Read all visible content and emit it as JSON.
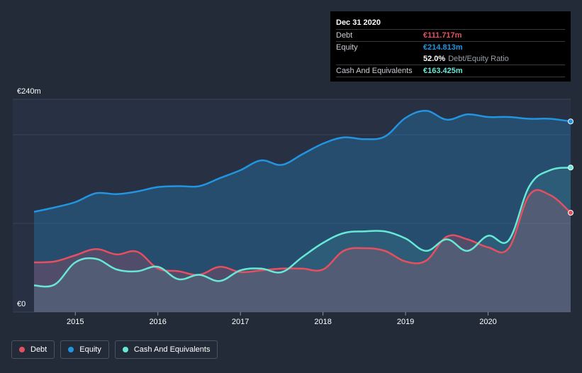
{
  "colors": {
    "debt": "#e64f5f",
    "equity": "#2394df",
    "cash": "#67e8d6"
  },
  "tooltip": {
    "date": "Dec 31 2020",
    "debt_label": "Debt",
    "debt_value": "€111.717m",
    "equity_label": "Equity",
    "equity_value": "€214.813m",
    "ratio_value": "52.0%",
    "ratio_label": "Debt/Equity Ratio",
    "cash_label": "Cash And Equivalents",
    "cash_value": "€163.425m"
  },
  "legend": {
    "debt": "Debt",
    "equity": "Equity",
    "cash": "Cash And Equivalents"
  },
  "chart_data": {
    "type": "area",
    "ylim": [
      0,
      240
    ],
    "y_ticks": [
      {
        "value": 240,
        "label": "€240m"
      },
      {
        "value": 0,
        "label": "€0"
      }
    ],
    "x_range": [
      2014.5,
      2021.0
    ],
    "x_ticks": [
      {
        "value": 2015,
        "label": "2015"
      },
      {
        "value": 2016,
        "label": "2016"
      },
      {
        "value": 2017,
        "label": "2017"
      },
      {
        "value": 2018,
        "label": "2018"
      },
      {
        "value": 2019,
        "label": "2019"
      },
      {
        "value": 2020,
        "label": "2020"
      }
    ],
    "grid": true,
    "legend_position": "bottom-left",
    "series": [
      {
        "name": "Equity",
        "key": "equity",
        "x": [
          2014.5,
          2014.75,
          2015.0,
          2015.25,
          2015.5,
          2015.75,
          2016.0,
          2016.25,
          2016.5,
          2016.75,
          2017.0,
          2017.25,
          2017.5,
          2017.75,
          2018.0,
          2018.25,
          2018.5,
          2018.75,
          2019.0,
          2019.25,
          2019.5,
          2019.75,
          2020.0,
          2020.25,
          2020.5,
          2020.75,
          2021.0
        ],
        "values": [
          113,
          118,
          124,
          134,
          133,
          136,
          141,
          142,
          142,
          151,
          160,
          171,
          166,
          178,
          190,
          197,
          195,
          198,
          219,
          227,
          217,
          223,
          220,
          220,
          218,
          218,
          215
        ]
      },
      {
        "name": "Debt",
        "key": "debt",
        "x": [
          2014.5,
          2014.75,
          2015.0,
          2015.25,
          2015.5,
          2015.75,
          2016.0,
          2016.25,
          2016.5,
          2016.75,
          2017.0,
          2017.25,
          2017.5,
          2017.75,
          2018.0,
          2018.25,
          2018.5,
          2018.75,
          2019.0,
          2019.25,
          2019.5,
          2019.75,
          2020.0,
          2020.25,
          2020.5,
          2020.75,
          2021.0
        ],
        "values": [
          56,
          57,
          64,
          71,
          65,
          68,
          49,
          46,
          42,
          51,
          45,
          47,
          49,
          49,
          48,
          69,
          72,
          69,
          57,
          58,
          85,
          82,
          73,
          72,
          132,
          132,
          112
        ]
      },
      {
        "name": "Cash And Equivalents",
        "key": "cash",
        "x": [
          2014.5,
          2014.75,
          2015.0,
          2015.25,
          2015.5,
          2015.75,
          2016.0,
          2016.25,
          2016.5,
          2016.75,
          2017.0,
          2017.25,
          2017.5,
          2017.75,
          2018.0,
          2018.25,
          2018.5,
          2018.75,
          2019.0,
          2019.25,
          2019.5,
          2019.75,
          2020.0,
          2020.25,
          2020.5,
          2020.75,
          2021.0
        ],
        "values": [
          30,
          31,
          56,
          60,
          48,
          46,
          51,
          37,
          42,
          35,
          47,
          49,
          45,
          62,
          78,
          89,
          91,
          91,
          83,
          69,
          82,
          69,
          86,
          81,
          142,
          160,
          163
        ]
      }
    ]
  }
}
